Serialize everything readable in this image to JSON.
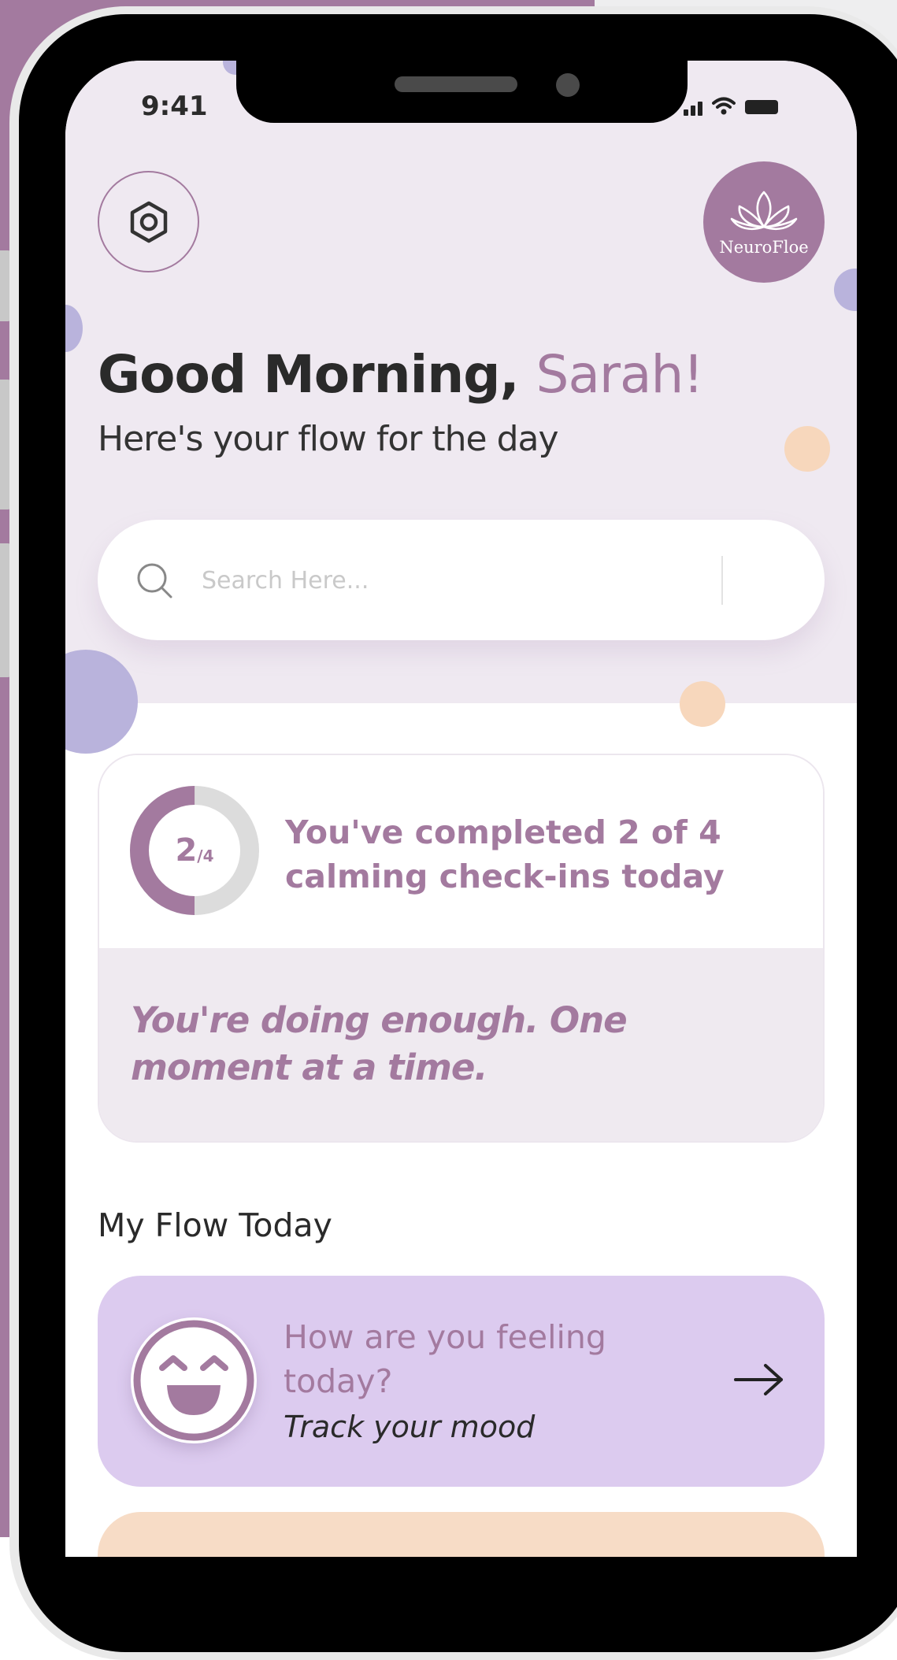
{
  "status_bar": {
    "time": "9:41"
  },
  "header": {
    "logo_text": "NeuroFloe",
    "greeting": "Good Morning,",
    "user_name": "Sarah!",
    "subtitle": "Here's your flow for the day"
  },
  "search": {
    "placeholder": "Search Here..."
  },
  "progress": {
    "completed": 2,
    "total": 4,
    "ring_count": "2",
    "ring_total": "/4",
    "summary": "You've completed 2 of 4 calming check-ins today",
    "encouragement": "You're doing enough. One moment at a time."
  },
  "flow": {
    "section_title": "My Flow Today",
    "mood_card": {
      "title": "How are you feeling today?",
      "subtitle": "Track your mood"
    }
  },
  "colors": {
    "brand": "#a37a9f",
    "mood_card": "#dccbef",
    "next_card": "#f7dcc6",
    "header_bg": "#efe9f1"
  },
  "icons": {
    "settings": "hexagon-settings-icon",
    "search": "search-icon",
    "logo": "lotus-icon",
    "mood": "smiling-face-icon",
    "arrow": "arrow-right-icon"
  }
}
